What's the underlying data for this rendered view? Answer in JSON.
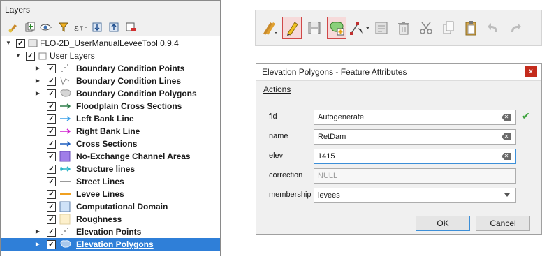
{
  "layers_panel": {
    "title": "Layers",
    "toolbar_icons": [
      "style-manager-icon",
      "add-group-icon",
      "visibility-eye-icon",
      "filter-icon",
      "expression-filter-icon",
      "expand-all-icon",
      "collapse-all-icon",
      "remove-layer-icon"
    ],
    "project": {
      "name": "FLO-2D_UserManualLeveeTool 0.9.4"
    },
    "group": {
      "name": "User Layers"
    },
    "layers": [
      {
        "label": "Boundary Condition Points",
        "expandable": true,
        "symbol": "dots"
      },
      {
        "label": "Boundary Condition Lines",
        "expandable": true,
        "symbol": "polyline"
      },
      {
        "label": "Boundary Condition Polygons",
        "expandable": true,
        "symbol": "blob-grey"
      },
      {
        "label": "Floodplain Cross Sections",
        "expandable": false,
        "symbol": "arrow",
        "color": "#2e7d4a"
      },
      {
        "label": "Left Bank Line",
        "expandable": false,
        "symbol": "arrow",
        "color": "#3aa0e8"
      },
      {
        "label": "Right Bank Line",
        "expandable": false,
        "symbol": "arrow",
        "color": "#d020d0"
      },
      {
        "label": "Cross Sections",
        "expandable": false,
        "symbol": "arrow",
        "color": "#1f5fbf"
      },
      {
        "label": "No-Exchange Channel Areas",
        "expandable": false,
        "symbol": "fill",
        "color": "#a07ee8"
      },
      {
        "label": "Structure lines",
        "expandable": false,
        "symbol": "double-arrow",
        "color": "#2bb5c8"
      },
      {
        "label": "Street Lines",
        "expandable": false,
        "symbol": "line",
        "color": "#555555"
      },
      {
        "label": "Levee Lines",
        "expandable": false,
        "symbol": "line",
        "color": "#f0a020"
      },
      {
        "label": "Computational Domain",
        "expandable": false,
        "symbol": "fill",
        "color": "#cfe2f8"
      },
      {
        "label": "Roughness",
        "expandable": false,
        "symbol": "fill",
        "color": "#fdf0cc"
      },
      {
        "label": "Elevation Points",
        "expandable": true,
        "symbol": "dots"
      },
      {
        "label": "Elevation Polygons",
        "expandable": true,
        "symbol": "blob-blue",
        "selected": true
      }
    ]
  },
  "digitizing_toolbar": {
    "icons": [
      "current-edits-icon",
      "toggle-editing-icon",
      "save-edits-icon",
      "add-polygon-feature-icon",
      "vertex-tool-icon",
      "modify-attributes-icon",
      "delete-selected-icon",
      "cut-features-icon",
      "copy-features-icon",
      "paste-features-icon",
      "undo-icon",
      "redo-icon"
    ]
  },
  "dialog": {
    "title": "Elevation Polygons - Feature Attributes",
    "close_label": "x",
    "menu": "Actions",
    "fields": [
      {
        "label": "fid",
        "value": "Autogenerate"
      },
      {
        "label": "name",
        "value": "RetDam"
      },
      {
        "label": "elev",
        "value": "1415"
      },
      {
        "label": "correction",
        "value": "NULL"
      },
      {
        "label": "membership",
        "value": "levees"
      }
    ],
    "ok_label": "OK",
    "cancel_label": "Cancel"
  }
}
